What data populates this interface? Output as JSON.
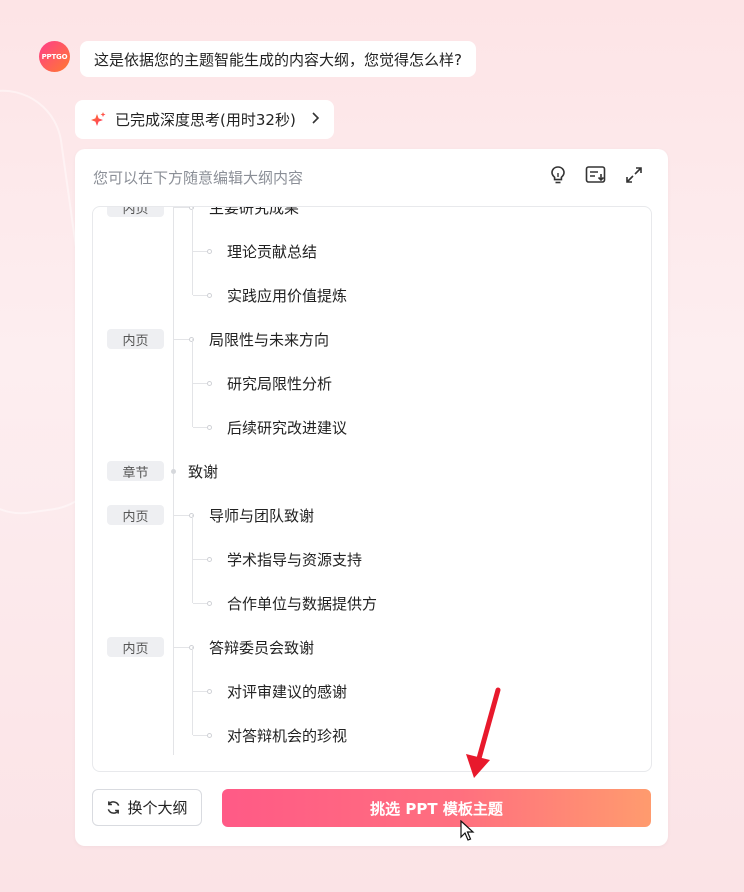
{
  "chat": {
    "avatar_text": "PPTGO",
    "message": "这是依据您的主题智能生成的内容大纲，您觉得怎么样?",
    "thinking_label": "已完成深度思考(用时32秒)"
  },
  "card": {
    "hint": "您可以在下方随意编辑大纲内容",
    "tools": [
      "lightbulb-icon",
      "list-edit-icon",
      "expand-icon"
    ]
  },
  "outline": {
    "items": [
      {
        "tag": "内页",
        "text": "主要研究成果",
        "level": 1
      },
      {
        "tag": "",
        "text": "理论贡献总结",
        "level": 2
      },
      {
        "tag": "",
        "text": "实践应用价值提炼",
        "level": 2
      },
      {
        "tag": "内页",
        "text": "局限性与未来方向",
        "level": 1
      },
      {
        "tag": "",
        "text": "研究局限性分析",
        "level": 2
      },
      {
        "tag": "",
        "text": "后续研究改进建议",
        "level": 2
      },
      {
        "tag": "章节",
        "text": "致谢",
        "level": 0
      },
      {
        "tag": "内页",
        "text": "导师与团队致谢",
        "level": 1
      },
      {
        "tag": "",
        "text": "学术指导与资源支持",
        "level": 2
      },
      {
        "tag": "",
        "text": "合作单位与数据提供方",
        "level": 2
      },
      {
        "tag": "内页",
        "text": "答辩委员会致谢",
        "level": 1
      },
      {
        "tag": "",
        "text": "对评审建议的感谢",
        "level": 2
      },
      {
        "tag": "",
        "text": "对答辩机会的珍视",
        "level": 2
      }
    ]
  },
  "buttons": {
    "swap_label": "换个大纲",
    "main_label": "挑选 PPT 模板主题"
  },
  "colors": {
    "accent_start": "#ff5a86",
    "accent_end": "#ff9b6e",
    "annotation_arrow": "#e8192c"
  }
}
